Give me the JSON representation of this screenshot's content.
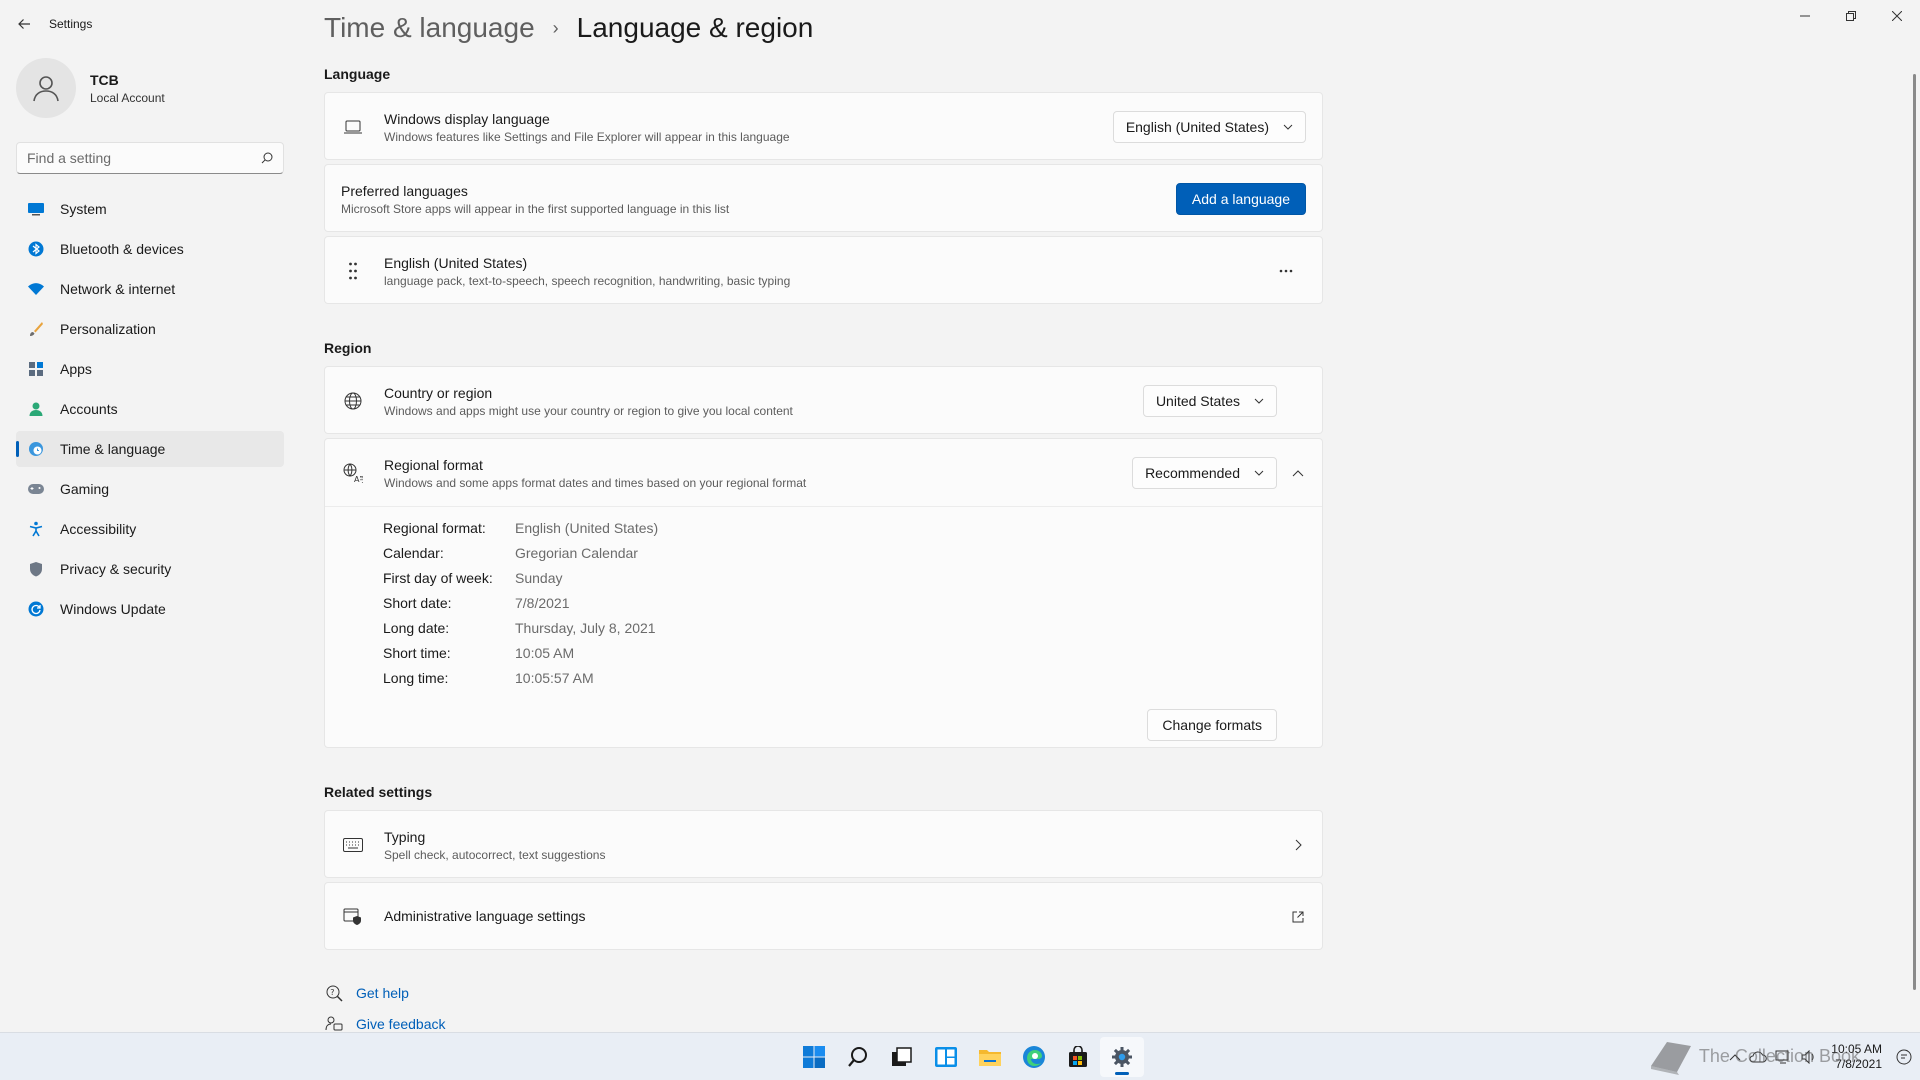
{
  "window": {
    "app_title": "Settings"
  },
  "profile": {
    "name": "TCB",
    "account_type": "Local Account"
  },
  "search": {
    "placeholder": "Find a setting"
  },
  "nav": {
    "items": [
      {
        "label": "System",
        "icon": "system-icon"
      },
      {
        "label": "Bluetooth & devices",
        "icon": "bluetooth-icon"
      },
      {
        "label": "Network & internet",
        "icon": "wifi-icon"
      },
      {
        "label": "Personalization",
        "icon": "brush-icon"
      },
      {
        "label": "Apps",
        "icon": "apps-icon"
      },
      {
        "label": "Accounts",
        "icon": "person-icon"
      },
      {
        "label": "Time & language",
        "icon": "globe-clock-icon"
      },
      {
        "label": "Gaming",
        "icon": "gamepad-icon"
      },
      {
        "label": "Accessibility",
        "icon": "accessibility-icon"
      },
      {
        "label": "Privacy & security",
        "icon": "shield-icon"
      },
      {
        "label": "Windows Update",
        "icon": "update-icon"
      }
    ]
  },
  "header": {
    "parent": "Time & language",
    "current": "Language & region"
  },
  "language": {
    "section_title": "Language",
    "display_language": {
      "title": "Windows display language",
      "description": "Windows features like Settings and File Explorer will appear in this language",
      "value": "English (United States)"
    },
    "preferred": {
      "title": "Preferred languages",
      "description": "Microsoft Store apps will appear in the first supported language in this list",
      "button": "Add a language"
    },
    "installed": {
      "title": "English (United States)",
      "description": "language pack, text-to-speech, speech recognition, handwriting, basic typing"
    }
  },
  "region": {
    "section_title": "Region",
    "country": {
      "title": "Country or region",
      "description": "Windows and apps might use your country or region to give you local content",
      "value": "United States"
    },
    "format": {
      "title": "Regional format",
      "description": "Windows and some apps format dates and times based on your regional format",
      "value": "Recommended",
      "details": [
        {
          "label": "Regional format:",
          "value": "English (United States)"
        },
        {
          "label": "Calendar:",
          "value": "Gregorian Calendar"
        },
        {
          "label": "First day of week:",
          "value": "Sunday"
        },
        {
          "label": "Short date:",
          "value": "7/8/2021"
        },
        {
          "label": "Long date:",
          "value": "Thursday, July 8, 2021"
        },
        {
          "label": "Short time:",
          "value": "10:05 AM"
        },
        {
          "label": "Long time:",
          "value": "10:05:57 AM"
        }
      ],
      "change_button": "Change formats"
    }
  },
  "related": {
    "section_title": "Related settings",
    "typing": {
      "title": "Typing",
      "description": "Spell check, autocorrect, text suggestions"
    },
    "admin": {
      "title": "Administrative language settings"
    }
  },
  "help": {
    "get_help": "Get help",
    "give_feedback": "Give feedback"
  },
  "taskbar": {
    "clock_time": "10:05 AM",
    "clock_date": "7/8/2021",
    "watermark": "The Collection Book",
    "accent": "#005fb8"
  }
}
